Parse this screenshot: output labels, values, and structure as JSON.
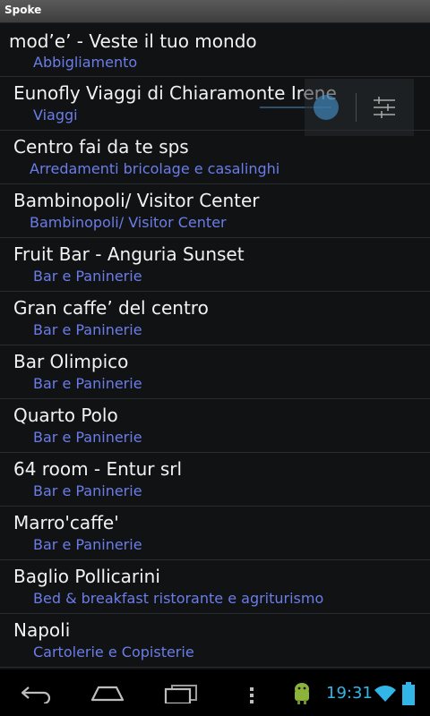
{
  "app": {
    "title": "Spoke"
  },
  "list": [
    {
      "name": "mod’e’  - Veste il tuo mondo",
      "category": "Abbigliamento"
    },
    {
      "name": "Eunofly Viaggi di Chiaramonte Irene",
      "category": "Viaggi"
    },
    {
      "name": "Centro fai da te sps",
      "category": "Arredamenti bricolage e casalinghi"
    },
    {
      "name": "Bambinopoli/ Visitor Center",
      "category": "Bambinopoli/ Visitor Center"
    },
    {
      "name": "Fruit Bar - Anguria Sunset",
      "category": "Bar e Paninerie"
    },
    {
      "name": "Gran caffe’ del centro",
      "category": "Bar e Paninerie"
    },
    {
      "name": "Bar Olimpico",
      "category": "Bar e Paninerie"
    },
    {
      "name": "Quarto Polo",
      "category": "Bar e Paninerie"
    },
    {
      "name": "64 room - Entur srl",
      "category": "Bar e Paninerie"
    },
    {
      "name": "Marro'caffe'",
      "category": "Bar e Paninerie"
    },
    {
      "name": "Baglio Pollicarini",
      "category": "Bed & breakfast ristorante e agriturismo"
    },
    {
      "name": "Napoli",
      "category": "Cartolerie e Copisterie"
    }
  ],
  "status_bar": {
    "time": "19:31"
  },
  "colors": {
    "accent": "#31b6e7",
    "category_text": "#6b7de8",
    "title_bar": "#4a4a4a"
  },
  "icons": {
    "nav": [
      "back-icon",
      "home-icon",
      "recent-apps-icon",
      "menu-icon"
    ],
    "status": [
      "android-notification-icon",
      "wifi-icon",
      "battery-icon"
    ],
    "overlay": [
      "sliders-icon"
    ]
  }
}
